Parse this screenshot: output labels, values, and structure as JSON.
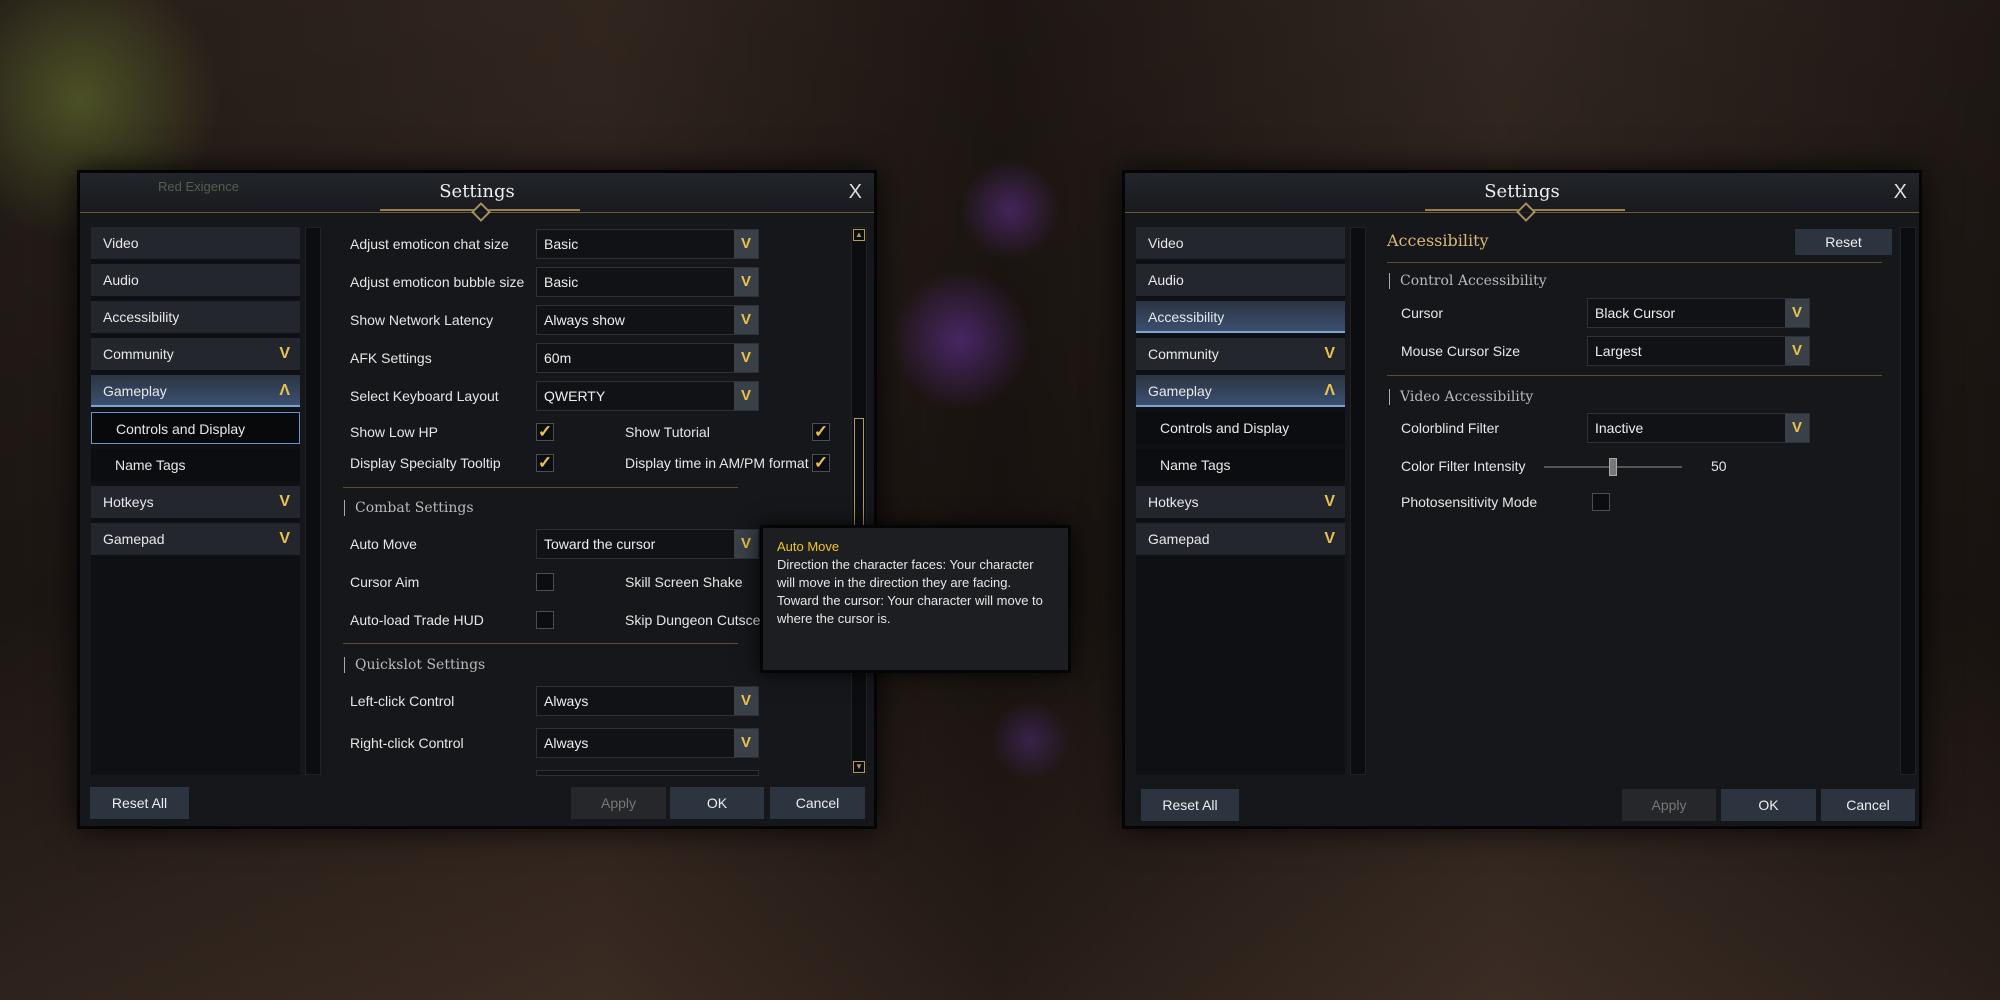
{
  "colors": {
    "accent": "#e8c24a",
    "tooltip_title": "#f3c51a",
    "active_tab": "#3b5070"
  },
  "left_window": {
    "title": "Settings",
    "close": "X",
    "watermark": "Red Exigence",
    "sidebar": [
      {
        "label": "Video"
      },
      {
        "label": "Audio"
      },
      {
        "label": "Accessibility"
      },
      {
        "label": "Community",
        "chevron": "V"
      },
      {
        "label": "Gameplay",
        "chevron": "Λ",
        "state": "active"
      },
      {
        "label": "Controls and Display",
        "sub": true,
        "state": "selected"
      },
      {
        "label": "Name Tags",
        "sub": true
      },
      {
        "label": "Hotkeys",
        "chevron": "V"
      },
      {
        "label": "Gamepad",
        "chevron": "V"
      }
    ],
    "dropdowns": [
      {
        "label": "Adjust emoticon chat size",
        "value": "Basic"
      },
      {
        "label": "Adjust emoticon bubble size",
        "value": "Basic"
      },
      {
        "label": "Show Network Latency",
        "value": "Always show"
      },
      {
        "label": "AFK Settings",
        "value": "60m"
      },
      {
        "label": "Select Keyboard Layout",
        "value": "QWERTY"
      }
    ],
    "checks": [
      {
        "label": "Show Low HP",
        "checked": true
      },
      {
        "label": "Show Tutorial",
        "checked": true
      },
      {
        "label": "Display Specialty Tooltip",
        "checked": true
      },
      {
        "label": "Display time in AM/PM format",
        "checked": true
      }
    ],
    "combat": {
      "title": "Combat Settings",
      "auto_move": {
        "label": "Auto Move",
        "value": "Toward the cursor"
      },
      "cursor_aim": "Cursor Aim",
      "skill_shake": "Skill Screen Shake",
      "trade_hud": "Auto-load Trade HUD",
      "skip_cutscene": "Skip Dungeon Cutscer"
    },
    "quickslot": {
      "title": "Quickslot Settings",
      "left": {
        "label": "Left-click Control",
        "value": "Always"
      },
      "right": {
        "label": "Right-click Control",
        "value": "Always"
      }
    },
    "buttons": {
      "reset_all": "Reset All",
      "apply": "Apply",
      "ok": "OK",
      "cancel": "Cancel"
    },
    "tooltip": {
      "title": "Auto Move",
      "line1": "Direction the character faces: Your character will move in the direction they are facing.",
      "line2": "Toward the cursor: Your character will move to where the cursor is."
    }
  },
  "right_window": {
    "title": "Settings",
    "close": "X",
    "sidebar": [
      {
        "label": "Video"
      },
      {
        "label": "Audio"
      },
      {
        "label": "Accessibility",
        "state": "active"
      },
      {
        "label": "Community",
        "chevron": "V"
      },
      {
        "label": "Gameplay",
        "chevron": "Λ",
        "state": "active"
      },
      {
        "label": "Controls and Display",
        "sub": true
      },
      {
        "label": "Name Tags",
        "sub": true
      },
      {
        "label": "Hotkeys",
        "chevron": "V"
      },
      {
        "label": "Gamepad",
        "chevron": "V"
      }
    ],
    "header": "Accessibility",
    "reset": "Reset",
    "control_title": "Control Accessibility",
    "cursor": {
      "label": "Cursor",
      "value": "Black Cursor"
    },
    "cursor_size": {
      "label": "Mouse Cursor Size",
      "value": "Largest"
    },
    "video_title": "Video Accessibility",
    "colorblind": {
      "label": "Colorblind Filter",
      "value": "Inactive"
    },
    "intensity": {
      "label": "Color Filter Intensity",
      "value": "50",
      "max": 100
    },
    "photosensitivity": {
      "label": "Photosensitivity Mode",
      "checked": false
    },
    "buttons": {
      "reset_all": "Reset All",
      "apply": "Apply",
      "ok": "OK",
      "cancel": "Cancel"
    }
  }
}
